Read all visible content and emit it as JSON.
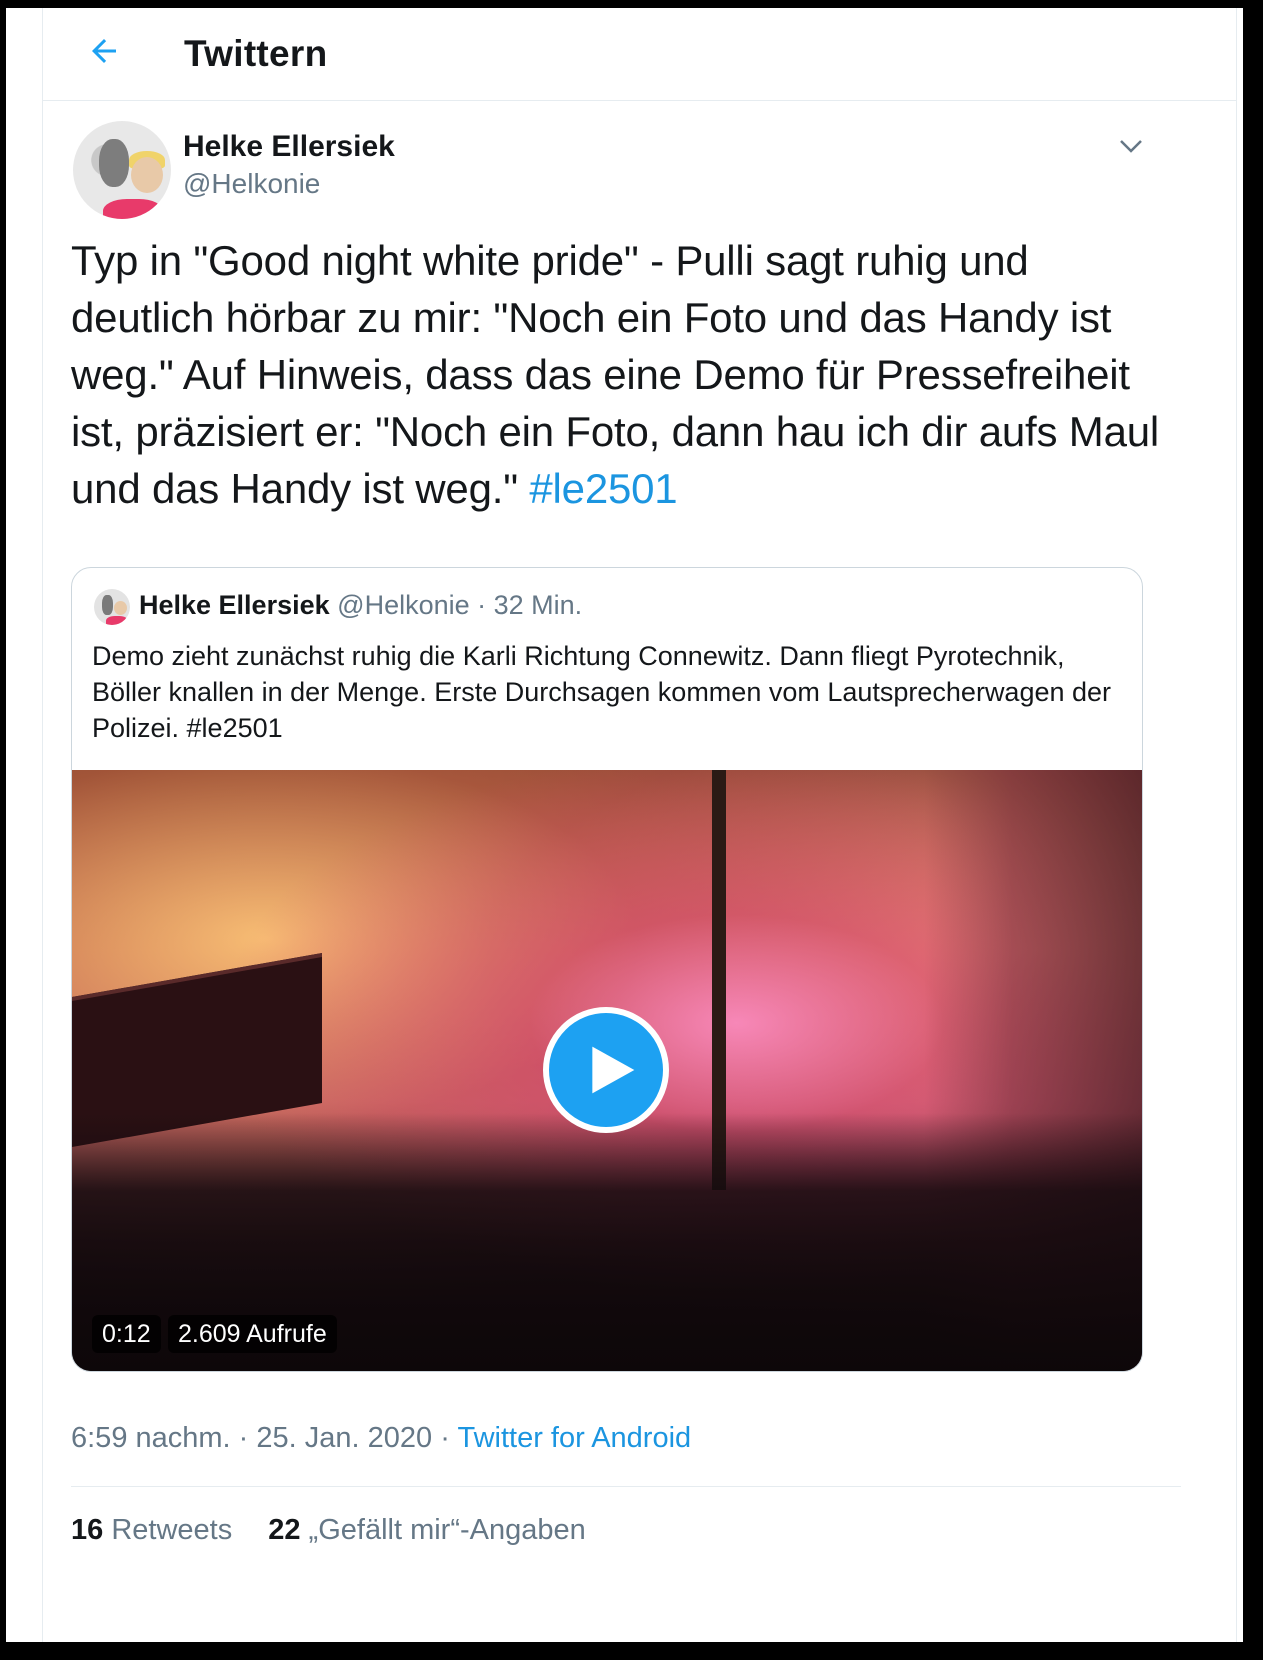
{
  "header": {
    "title": "Twittern",
    "back_icon": "arrow-left-icon"
  },
  "tweet": {
    "author_name": "Helke Ellersiek",
    "author_handle": "@Helkonie",
    "text": "Typ in \"Good night white pride\" - Pulli sagt ruhig und deutlich hörbar zu mir: \"Noch ein Foto und das Handy ist weg.\" Auf Hinweis, dass das eine Demo für Pressefreiheit ist, präzisiert er: \"Noch ein Foto, dann hau ich dir aufs Maul und das Handy ist weg.\" ",
    "hashtag": "#le2501",
    "more_icon": "chevron-down-icon",
    "time": "6:59 nachm.",
    "date": "25. Jan. 2020",
    "separator": "·",
    "source": "Twitter for Android",
    "retweets_count": "16",
    "retweets_label": "Retweets",
    "likes_count": "22",
    "likes_label": "„Gefällt mir“-Angaben"
  },
  "quoted_tweet": {
    "author_name": "Helke Ellersiek",
    "author_handle": "@Helkonie",
    "age": "· 32 Min.",
    "text": "Demo zieht zunächst ruhig die Karli Richtung Connewitz. Dann fliegt Pyrotechnik, Böller knallen in der Menge. Erste Durchsagen kommen vom Lautsprecherwagen der Polizei. #le2501",
    "video": {
      "duration": "0:12",
      "views": "2.609 Aufrufe",
      "play_icon": "play-icon"
    }
  },
  "colors": {
    "accent": "#1da1f2",
    "link": "#1b95e0",
    "secondary_text": "#657786",
    "border": "#e6ecf0"
  }
}
